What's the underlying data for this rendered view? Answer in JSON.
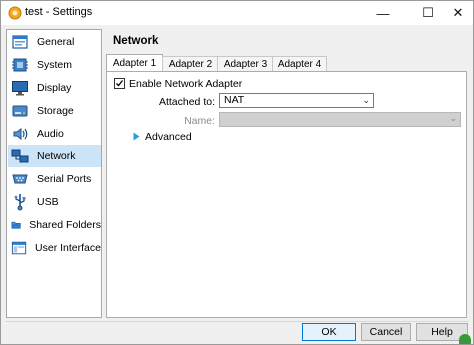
{
  "window": {
    "title": "test - Settings"
  },
  "titlebar": {
    "minimize": "—",
    "maximize": "☐",
    "close": "✕"
  },
  "sidebar": {
    "items": [
      {
        "label": "General",
        "icon": "general-icon"
      },
      {
        "label": "System",
        "icon": "system-icon"
      },
      {
        "label": "Display",
        "icon": "display-icon"
      },
      {
        "label": "Storage",
        "icon": "storage-icon"
      },
      {
        "label": "Audio",
        "icon": "audio-icon"
      },
      {
        "label": "Network",
        "icon": "network-icon",
        "selected": true
      },
      {
        "label": "Serial Ports",
        "icon": "serial-ports-icon"
      },
      {
        "label": "USB",
        "icon": "usb-icon"
      },
      {
        "label": "Shared Folders",
        "icon": "shared-folders-icon"
      },
      {
        "label": "User Interface",
        "icon": "user-interface-icon"
      }
    ]
  },
  "main": {
    "title": "Network",
    "tabs": [
      {
        "label": "Adapter 1",
        "active": true
      },
      {
        "label": "Adapter 2"
      },
      {
        "label": "Adapter 3"
      },
      {
        "label": "Adapter 4"
      }
    ],
    "enable_adapter_label": "Enable Network Adapter",
    "enable_adapter_checked": true,
    "attached_to_label": "Attached to:",
    "attached_to_value": "NAT",
    "name_label": "Name:",
    "name_value": "",
    "advanced_label": "Advanced"
  },
  "buttons": {
    "ok": "OK",
    "cancel": "Cancel",
    "help": "Help"
  },
  "colors": {
    "selected_bg": "#cce4f7",
    "accent": "#0078d7"
  }
}
